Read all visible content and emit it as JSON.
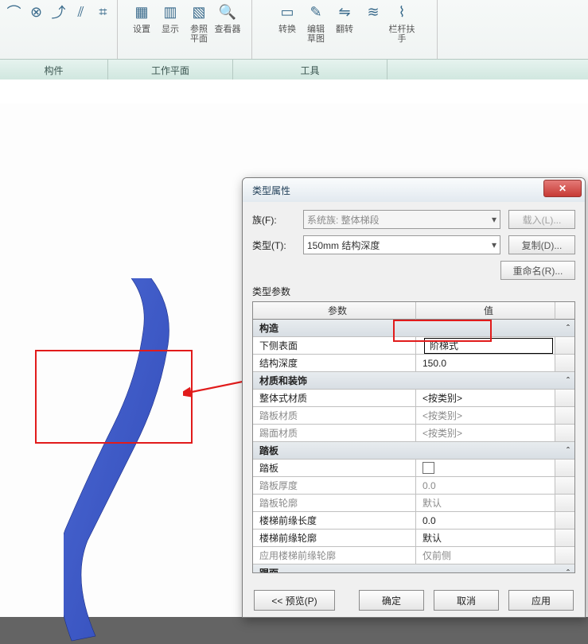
{
  "ribbon": {
    "g1": {
      "btns": [
        {
          "icon": "⌒",
          "label": ""
        },
        {
          "icon": "⊗",
          "label": ""
        },
        {
          "icon": "⤴",
          "label": ""
        },
        {
          "icon": "⫽",
          "label": ""
        },
        {
          "icon": "⌗",
          "label": ""
        }
      ],
      "caption": "构件"
    },
    "g2": {
      "btns": [
        {
          "icon": "▦",
          "label": "设置"
        },
        {
          "icon": "▥",
          "label": "显示"
        },
        {
          "icon": "▧",
          "label": "参照\n平面"
        },
        {
          "icon": "🔍",
          "label": "查看器"
        }
      ],
      "caption": "工作平面"
    },
    "g3": {
      "btns": [
        {
          "icon": "▭",
          "label": "转换"
        },
        {
          "icon": "✎",
          "label": "编辑\n草图"
        },
        {
          "icon": "⇋",
          "label": "翻转"
        },
        {
          "icon": "≋",
          "label": ""
        },
        {
          "icon": "⌇",
          "label": "栏杆扶手"
        }
      ],
      "caption": "工具"
    }
  },
  "dialog": {
    "title": "类型属性",
    "family_label": "族(F):",
    "family_value": "系统族: 整体梯段",
    "type_label": "类型(T):",
    "type_value": "150mm 结构深度",
    "load": "载入(L)...",
    "copy": "复制(D)...",
    "rename": "重命名(R)...",
    "params_label": "类型参数",
    "col_param": "参数",
    "col_value": "值",
    "rows": [
      {
        "kind": "cat",
        "label": "构造"
      },
      {
        "kind": "row",
        "p": "下侧表面",
        "v": "阶梯式",
        "sel": true
      },
      {
        "kind": "row",
        "p": "结构深度",
        "v": "150.0"
      },
      {
        "kind": "cat",
        "label": "材质和装饰"
      },
      {
        "kind": "row",
        "p": "整体式材质",
        "v": "<按类别>"
      },
      {
        "kind": "row",
        "p": "踏板材质",
        "v": "<按类别>",
        "gray": true
      },
      {
        "kind": "row",
        "p": "踢面材质",
        "v": "<按类别>",
        "gray": true
      },
      {
        "kind": "cat",
        "label": "踏板"
      },
      {
        "kind": "row",
        "p": "踏板",
        "v": "__chk__"
      },
      {
        "kind": "row",
        "p": "踏板厚度",
        "v": "0.0",
        "gray": true
      },
      {
        "kind": "row",
        "p": "踏板轮廓",
        "v": "默认",
        "gray": true
      },
      {
        "kind": "row",
        "p": "楼梯前缘长度",
        "v": "0.0"
      },
      {
        "kind": "row",
        "p": "楼梯前缘轮廓",
        "v": "默认"
      },
      {
        "kind": "row",
        "p": "应用楼梯前缘轮廓",
        "v": "仅前侧",
        "gray": true
      },
      {
        "kind": "cat",
        "label": "踢面"
      }
    ],
    "preview": "<< 预览(P)",
    "ok": "确定",
    "cancel": "取消",
    "apply": "应用"
  }
}
